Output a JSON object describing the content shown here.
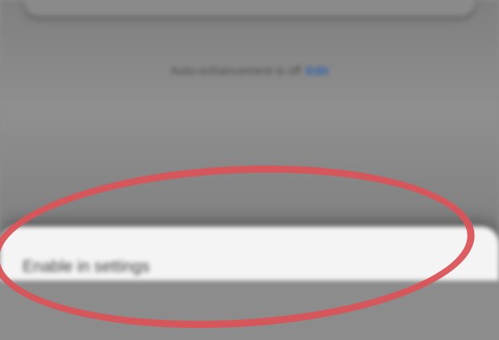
{
  "status": {
    "text": "Auto-enhancement is off",
    "link_label": "Edit"
  },
  "sheet": {
    "option_label": "Enable in settings"
  },
  "colors": {
    "dim_background": "#8c8c8c",
    "sheet_background": "#f4f4f4",
    "link": "#2d5fa8",
    "highlight": "#d9545a"
  }
}
